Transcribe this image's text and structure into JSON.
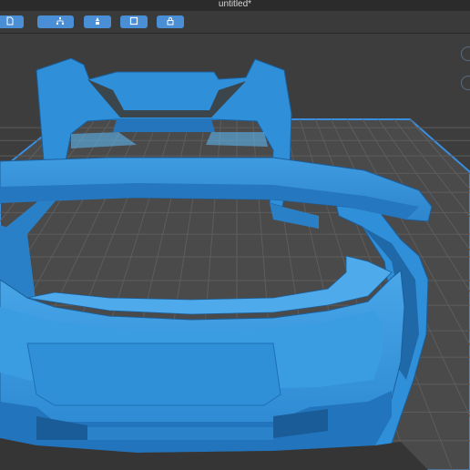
{
  "window": {
    "title": "untitled*"
  },
  "toolbar": {
    "buttons": [
      {
        "icon": "file-icon"
      },
      {
        "icon": "save-icon"
      },
      {
        "icon": "hierarchy-icon"
      },
      {
        "icon": "support-icon"
      },
      {
        "icon": "cube-view-icon"
      },
      {
        "icon": "lock-icon"
      }
    ]
  },
  "viewport": {
    "model": "car-body-shell",
    "colors": {
      "background": "#3d3d3d",
      "grid": "#5b5b5b",
      "plate": "#4a4a4a",
      "plate_border": "#3a8ee0",
      "model": "#2f8fd8",
      "model_dark": "#1b5f9c",
      "model_light": "#5db4ee"
    }
  }
}
